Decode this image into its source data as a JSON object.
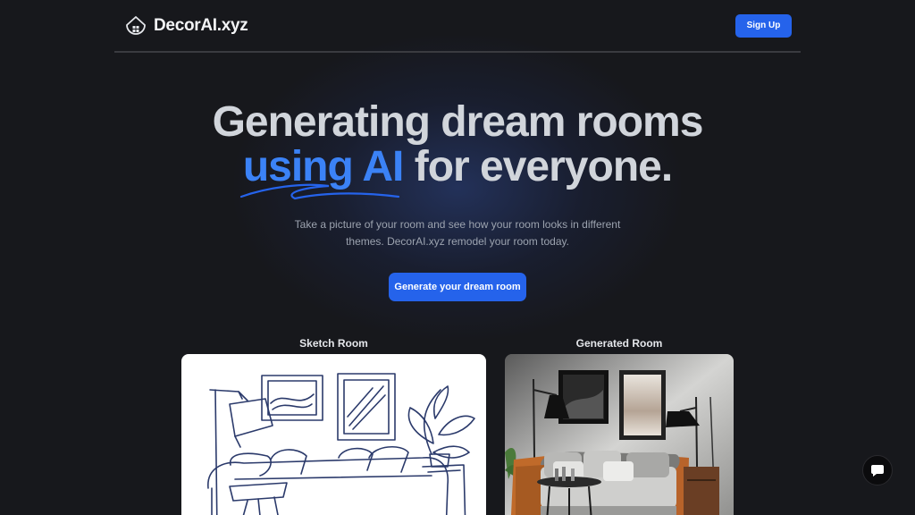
{
  "header": {
    "brand_name": "DecorAI.xyz",
    "signup_label": "Sign Up"
  },
  "hero": {
    "line1": "Generating dream rooms",
    "line2_accent": "using AI",
    "line2_rest": " for everyone.",
    "subtitle": "Take a picture of your room and see how your room looks in different themes. DecorAI.xyz remodel your room today.",
    "cta_label": "Generate your dream room"
  },
  "comparison": {
    "sketch_label": "Sketch Room",
    "generated_label": "Generated Room"
  },
  "icons": {
    "logo": "house-icon",
    "chat": "chat-bubble-icon"
  },
  "colors": {
    "background": "#17181c",
    "accent": "#3b82f6",
    "button": "#2563eb",
    "heading": "#d1d5db"
  }
}
